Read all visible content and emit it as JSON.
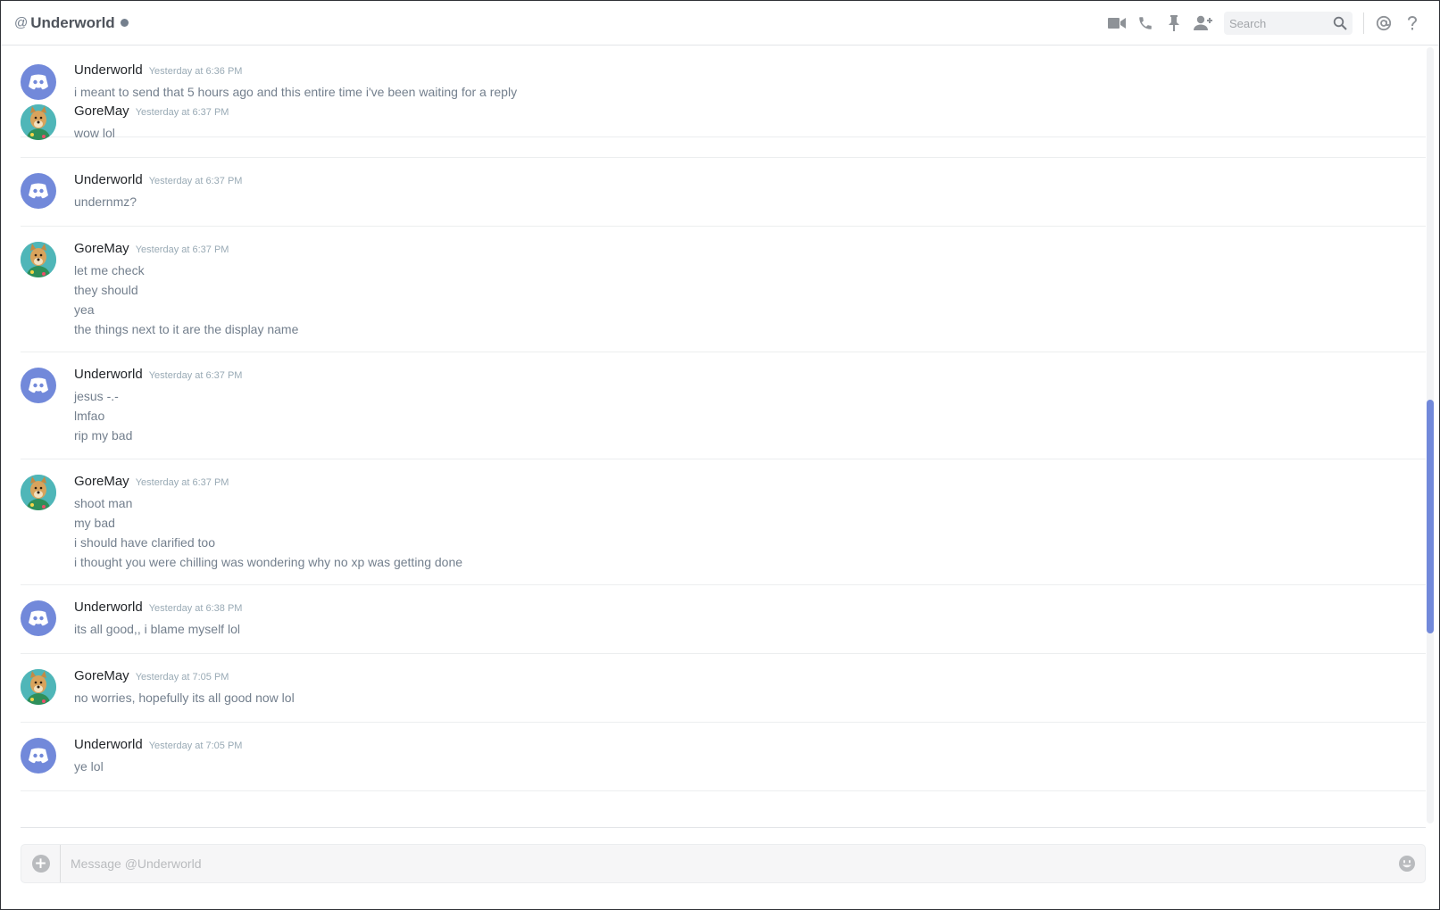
{
  "header": {
    "at_symbol": "@",
    "channel_name": "Underworld",
    "search_placeholder": "Search",
    "icons": [
      "video-call-icon",
      "voice-call-icon",
      "pin-icon",
      "add-friend-icon",
      "search-icon",
      "mention-icon",
      "help-icon"
    ]
  },
  "messages": [
    {
      "author": "Underworld",
      "avatar": "discord-logo",
      "timestamp": "Yesterday at 6:36 PM",
      "lines": [
        "i meant to send that 5 hours ago and this entire time i've been waiting for a reply"
      ]
    },
    {
      "author": "GoreMay",
      "avatar": "doge",
      "timestamp": "Yesterday at 6:37 PM",
      "lines": [
        "wow lol"
      ]
    },
    {
      "author": "Underworld",
      "avatar": "discord-logo",
      "timestamp": "Yesterday at 6:37 PM",
      "lines": [
        "undernmz?"
      ]
    },
    {
      "author": "GoreMay",
      "avatar": "doge",
      "timestamp": "Yesterday at 6:37 PM",
      "lines": [
        "let me check",
        "they should",
        "yea",
        "the things next to it are the display name"
      ]
    },
    {
      "author": "Underworld",
      "avatar": "discord-logo",
      "timestamp": "Yesterday at 6:37 PM",
      "lines": [
        "jesus -.-",
        "lmfao",
        "rip my bad"
      ]
    },
    {
      "author": "GoreMay",
      "avatar": "doge",
      "timestamp": "Yesterday at 6:37 PM",
      "lines": [
        "shoot man",
        "my bad",
        "i should have clarified too",
        "i thought you were chilling was wondering why no xp was getting done"
      ]
    },
    {
      "author": "Underworld",
      "avatar": "discord-logo",
      "timestamp": "Yesterday at 6:38 PM",
      "lines": [
        "its all good,, i blame myself lol"
      ]
    },
    {
      "author": "GoreMay",
      "avatar": "doge",
      "timestamp": "Yesterday at 7:05 PM",
      "lines": [
        "no worries, hopefully its all good now lol"
      ]
    },
    {
      "author": "Underworld",
      "avatar": "discord-logo",
      "timestamp": "Yesterday at 7:05 PM",
      "lines": [
        "ye lol"
      ]
    }
  ],
  "composer": {
    "placeholder": "Message @Underworld",
    "icons": [
      "add-attachment-icon",
      "emoji-icon"
    ]
  },
  "colors": {
    "blurple": "#7289da",
    "username": "#23262a",
    "message_text": "#737f8d",
    "timestamp": "#99aab5"
  }
}
